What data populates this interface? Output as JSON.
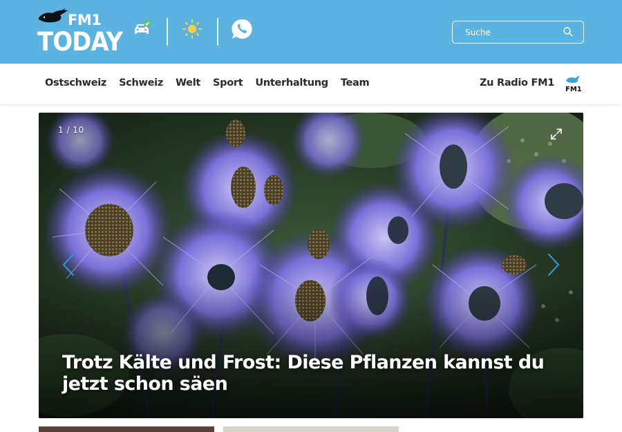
{
  "header": {
    "logo_top": "FM1",
    "logo_bottom": "TODAY",
    "icons": [
      "car-traffic-icon",
      "sun-weather-icon",
      "whatsapp-icon"
    ],
    "search": {
      "placeholder": "Suche"
    }
  },
  "nav": {
    "items": [
      "Ostschweiz",
      "Schweiz",
      "Welt",
      "Sport",
      "Unterhaltung",
      "Team"
    ],
    "radio_link": "Zu Radio FM1",
    "radio_logo_text": "FM1"
  },
  "gallery": {
    "counter": "1 / 10",
    "caption": "Trotz Kälte und Frost: Diese Pflanzen kannst du jetzt schon säen"
  },
  "colors": {
    "header_bg": "#5bb3e2",
    "text_dark": "#2a2a2a",
    "flower_purple": "#7a6fd6"
  }
}
